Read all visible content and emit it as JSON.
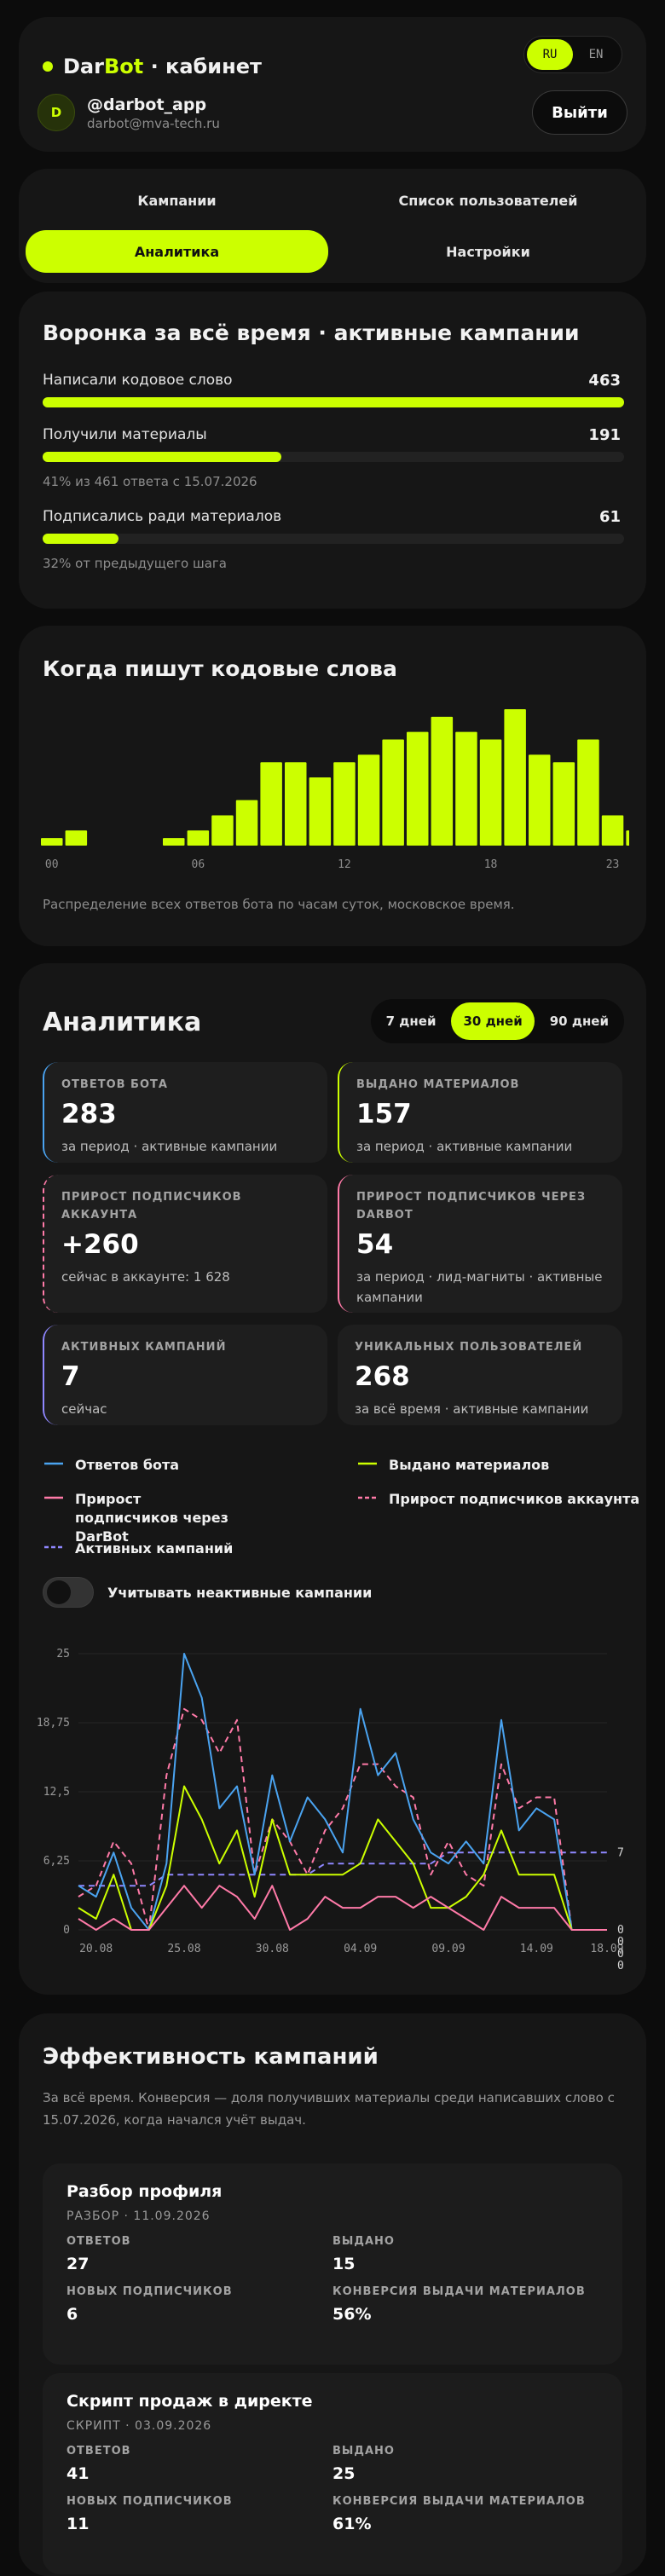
{
  "header": {
    "brand_dar": "Dar",
    "brand_bot": "Bot",
    "brand_rest": " · кабинет",
    "lang": [
      "RU",
      "EN"
    ],
    "lang_active": "RU",
    "avatar_letter": "D",
    "username": "@darbot_app",
    "email": "darbot@mva-tech.ru",
    "logout": "Выйти"
  },
  "tabs": [
    {
      "label": "Кампании",
      "active": false
    },
    {
      "label": "Список пользователей",
      "active": false
    },
    {
      "label": "Аналитика",
      "active": true
    },
    {
      "label": "Настройки",
      "active": false
    }
  ],
  "funnel": {
    "title": "Воронка за всё время · активные кампании",
    "rows": [
      {
        "label": "Написали кодовое слово",
        "value": "463",
        "fraction": 1.0
      },
      {
        "label": "Получили материалы",
        "value": "191",
        "fraction": 0.41
      },
      {
        "label": "Подписались ради материалов",
        "value": "61",
        "fraction": 0.13
      }
    ],
    "note1": "41% из 461 ответа с 15.07.2026",
    "note2": "32% от предыдущего шага"
  },
  "hours": {
    "title": "Когда пишут кодовые слова",
    "values": [
      1,
      2,
      0,
      0,
      0,
      1,
      2,
      4,
      6,
      11,
      11,
      9,
      11,
      12,
      14,
      15,
      17,
      15,
      14,
      18,
      12,
      11,
      14,
      4,
      2
    ],
    "tick_labels": [
      "00",
      "06",
      "12",
      "18",
      "23"
    ],
    "note": "Распределение всех ответов бота по часам суток, московское время."
  },
  "analytics": {
    "title": "Аналитика",
    "ranges": [
      "7 дней",
      "30 дней",
      "90 дней"
    ],
    "range_active": "30 дней",
    "stats": [
      {
        "label": "ОТВЕТОВ БОТА",
        "value": "283",
        "note": "за период · активные кампании",
        "accent": "#4aa3f0",
        "dashed": false
      },
      {
        "label": "ВЫДАНО МАТЕРИАЛОВ",
        "value": "157",
        "note": "за период · активные кампании",
        "accent": "#ccff00",
        "dashed": false
      },
      {
        "label": "ПРИРОСТ ПОДПИСЧИКОВ АККАУНТА",
        "value": "+260",
        "note": "сейчас в аккаунте: 1 628",
        "accent": "#ff7aa8",
        "dashed": true
      },
      {
        "label": "ПРИРОСТ ПОДПИСЧИКОВ ЧЕРЕЗ DARBOT",
        "value": "54",
        "note": "за период · лид-магниты · активные кампании",
        "accent": "#ff7aa8",
        "dashed": false
      },
      {
        "label": "АКТИВНЫХ КАМПАНИЙ",
        "value": "7",
        "note": "сейчас",
        "accent": "#8f87ff",
        "dashed": false
      },
      {
        "label": "УНИКАЛЬНЫХ ПОЛЬЗОВАТЕЛЕЙ",
        "value": "268",
        "note": "за всё время · активные кампании",
        "accent": "",
        "dashed": false
      }
    ],
    "legend": [
      {
        "label": "Ответов бота",
        "color": "#4aa3f0",
        "dash": false
      },
      {
        "label": "Выдано материалов",
        "color": "#ccff00",
        "dash": false
      },
      {
        "label": "Прирост подписчиков через DarBot",
        "color": "#ff7aa8",
        "dash": false
      },
      {
        "label": "Прирост подписчиков аккаунта",
        "color": "#ff7aa8",
        "dash": true
      },
      {
        "label": "Активных кампаний",
        "color": "#8f87ff",
        "dash": true
      }
    ],
    "toggle_label": "Учитывать неактивные кампании",
    "toggle_on": false
  },
  "chart_data": {
    "type": "line",
    "x": [
      "19.08",
      "20.08",
      "21.08",
      "22.08",
      "23.08",
      "24.08",
      "25.08",
      "26.08",
      "27.08",
      "28.08",
      "29.08",
      "30.08",
      "31.08",
      "01.09",
      "02.09",
      "03.09",
      "04.09",
      "05.09",
      "06.09",
      "07.09",
      "08.09",
      "09.09",
      "10.09",
      "11.09",
      "12.09",
      "13.09",
      "14.09",
      "15.09",
      "16.09",
      "17.09",
      "18.09"
    ],
    "x_tick_labels": [
      "20.08",
      "25.08",
      "30.08",
      "04.09",
      "09.09",
      "14.09",
      "18.09"
    ],
    "y_ticks": [
      0,
      6.25,
      12.5,
      18.75,
      25
    ],
    "y_tick_labels": [
      "0",
      "6,25",
      "12,5",
      "18,75",
      "25"
    ],
    "ylim": [
      0,
      25
    ],
    "grid": true,
    "series": [
      {
        "name": "Ответов бота",
        "color": "#4aa3f0",
        "dash": false,
        "values": [
          4,
          3,
          7,
          2,
          0,
          6,
          25,
          21,
          11,
          13,
          5,
          14,
          8,
          12,
          10,
          7,
          20,
          14,
          16,
          10,
          7,
          6,
          8,
          6,
          19,
          9,
          11,
          10,
          0,
          0,
          0
        ]
      },
      {
        "name": "Выдано материалов",
        "color": "#ccff00",
        "dash": false,
        "values": [
          2,
          1,
          5,
          0,
          0,
          4,
          13,
          10,
          6,
          9,
          3,
          10,
          5,
          5,
          5,
          5,
          6,
          10,
          8,
          6,
          2,
          2,
          3,
          5,
          9,
          5,
          5,
          5,
          0,
          0,
          0
        ]
      },
      {
        "name": "Прирост подписчиков через DarBot",
        "color": "#ff7aa8",
        "dash": false,
        "values": [
          1,
          0,
          1,
          0,
          0,
          2,
          4,
          2,
          4,
          3,
          1,
          4,
          0,
          1,
          3,
          2,
          2,
          3,
          3,
          2,
          3,
          2,
          1,
          0,
          3,
          2,
          2,
          2,
          0,
          0,
          0
        ]
      },
      {
        "name": "Прирост подписчиков аккаунта",
        "color": "#ff7aa8",
        "dash": true,
        "values": [
          3,
          4,
          8,
          6,
          0,
          14,
          20,
          19,
          16,
          19,
          5,
          10,
          8,
          5,
          9,
          11,
          15,
          15,
          13,
          12,
          5,
          8,
          5,
          4,
          15,
          11,
          12,
          12,
          0,
          0,
          0
        ]
      },
      {
        "name": "Активных кампаний",
        "color": "#8f87ff",
        "dash": true,
        "values": [
          4,
          4,
          4,
          4,
          4,
          5,
          5,
          5,
          5,
          5,
          5,
          5,
          5,
          5,
          6,
          6,
          6,
          6,
          6,
          6,
          6,
          7,
          7,
          7,
          7,
          7,
          7,
          7,
          7,
          7,
          7
        ]
      }
    ],
    "end_labels": [
      "7",
      "0",
      "0",
      "0",
      "0"
    ]
  },
  "efficiency": {
    "title": "Эффективность кампаний",
    "desc": "За всё время. Конверсия — доля получивших материалы среди написавших слово с 15.07.2026, когда начался учёт выдач.",
    "campaigns": [
      {
        "title": "Разбор профиля",
        "sub": "РАЗБОР · 11.09.2026",
        "stats": [
          {
            "label": "ОТВЕТОВ",
            "value": "27"
          },
          {
            "label": "ВЫДАНО",
            "value": "15"
          },
          {
            "label": "НОВЫХ ПОДПИСЧИКОВ",
            "value": "6"
          },
          {
            "label": "КОНВЕРСИЯ ВЫДАЧИ МАТЕРИАЛОВ",
            "value": "56%"
          }
        ]
      },
      {
        "title": "Скрипт продаж в директе",
        "sub": "СКРИПТ · 03.09.2026",
        "stats": [
          {
            "label": "ОТВЕТОВ",
            "value": "41"
          },
          {
            "label": "ВЫДАНО",
            "value": "25"
          },
          {
            "label": "НОВЫХ ПОДПИСЧИКОВ",
            "value": "11"
          },
          {
            "label": "КОНВЕРСИЯ ВЫДАЧИ МАТЕРИАЛОВ",
            "value": "61%"
          }
        ]
      }
    ]
  }
}
